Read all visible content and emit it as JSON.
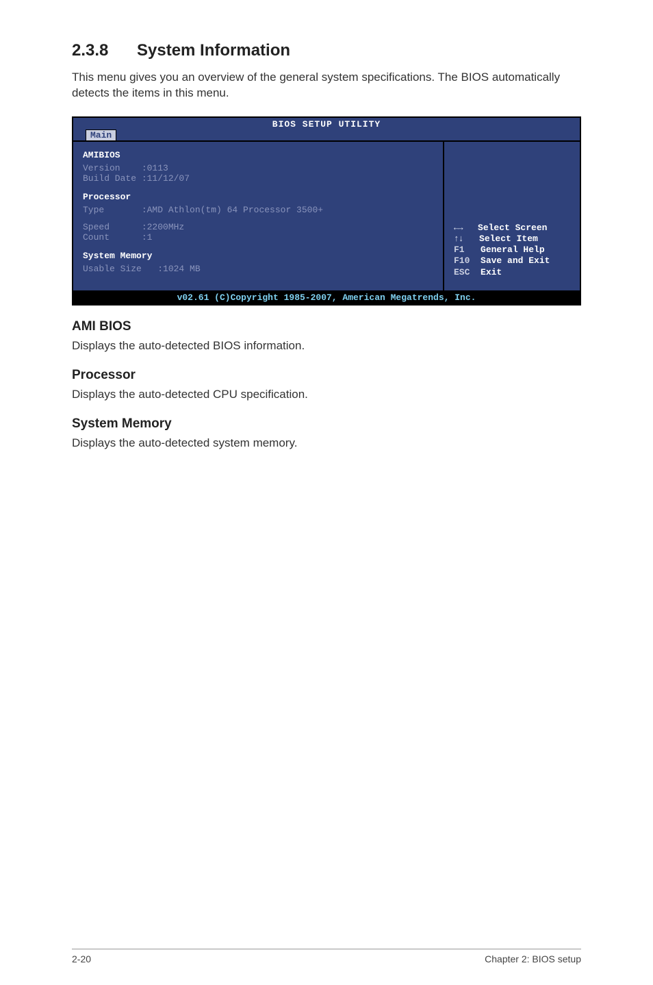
{
  "section": {
    "number": "2.3.8",
    "title": "System Information",
    "intro": "This menu gives you an overview of the general system specifications. The BIOS automatically detects the items in this menu."
  },
  "bios": {
    "title": "BIOS SETUP UTILITY",
    "tab": "Main",
    "left": {
      "amibios_hdr": "AMIBIOS",
      "version_row": "Version    :0113",
      "builddate_row": "Build Date :11/12/07",
      "processor_hdr": "Processor",
      "type_row": "Type       :AMD Athlon(tm) 64 Processor 3500+",
      "speed_row": "Speed      :2200MHz",
      "count_row": "Count      :1",
      "sysmem_hdr": "System Memory",
      "usable_row": "Usable Size   :1024 MB"
    },
    "help": {
      "l1_key_glyph": "←→",
      "l1_text": "Select Screen",
      "l2_key_glyph": "↑↓",
      "l2_text": "Select Item",
      "l3_key": "F1",
      "l3_text": "General Help",
      "l4_key": "F10",
      "l4_text": "Save and Exit",
      "l5_key": "ESC",
      "l5_text": "Exit"
    },
    "footer": "v02.61 (C)Copyright 1985-2007, American Megatrends, Inc."
  },
  "subs": {
    "ami_title": "AMI BIOS",
    "ami_body": "Displays the auto-detected BIOS information.",
    "proc_title": "Processor",
    "proc_body": "Displays the auto-detected CPU specification.",
    "mem_title": "System Memory",
    "mem_body": "Displays the auto-detected system memory."
  },
  "footer": {
    "left": "2-20",
    "right": "Chapter 2: BIOS setup"
  }
}
